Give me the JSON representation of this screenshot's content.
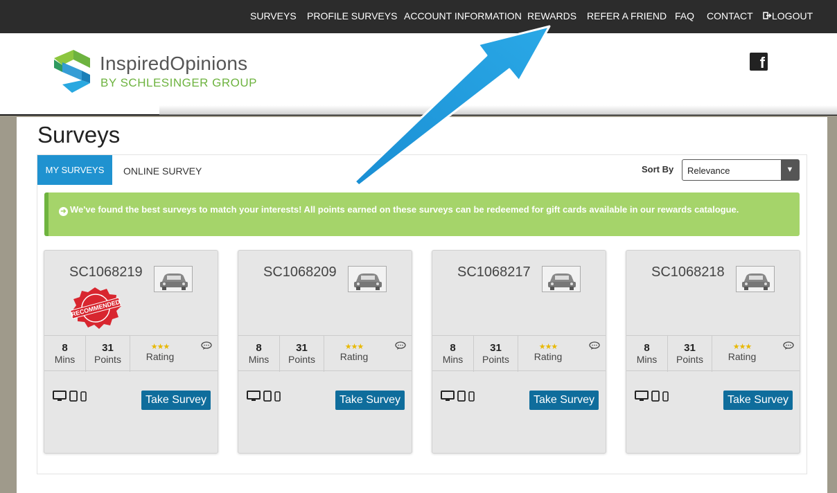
{
  "nav": {
    "items": [
      {
        "label": "SURVEYS",
        "name": "nav-surveys",
        "left": 0
      },
      {
        "label": "PROFILE SURVEYS"
      },
      {
        "label": "ACCOUNT INFORMATION"
      },
      {
        "label": "REWARDS"
      },
      {
        "label": "REFER A FRIEND"
      },
      {
        "label": "FAQ"
      },
      {
        "label": "CONTACT"
      },
      {
        "label": "LOGOUT",
        "icon": "logout-icon"
      }
    ]
  },
  "brand": {
    "name": "InspiredOpinions",
    "sub": "BY SCHLESINGER GROUP",
    "colors": {
      "green": "#6db33f",
      "blue": "#1f92d0",
      "gray": "#555555"
    }
  },
  "social": {
    "icon": "facebook-icon"
  },
  "page": {
    "title": "Surveys"
  },
  "tabs": [
    {
      "label": "MY SURVEYS",
      "active": true
    },
    {
      "label": "ONLINE SURVEY",
      "active": false
    }
  ],
  "sort": {
    "label": "Sort By",
    "value": "Relevance"
  },
  "alert": {
    "text": "We've found the best surveys to match your interests! All points earned on these surveys can be redeemed for gift cards available in our rewards catalogue.",
    "icon": "arrow-circle-right-icon"
  },
  "cards": [
    {
      "code": "SC1068219",
      "recommended": true,
      "badge_text": "RECOMMENDED",
      "mins": "8",
      "mins_label": "Mins",
      "points": "31",
      "points_label": "Points",
      "rating_stars": "★★★",
      "rating_label": "Rating",
      "button": "Take Survey"
    },
    {
      "code": "SC1068209",
      "recommended": false,
      "mins": "8",
      "mins_label": "Mins",
      "points": "31",
      "points_label": "Points",
      "rating_stars": "★★★",
      "rating_label": "Rating",
      "button": "Take Survey"
    },
    {
      "code": "SC1068217",
      "recommended": false,
      "mins": "8",
      "mins_label": "Mins",
      "points": "31",
      "points_label": "Points",
      "rating_stars": "★★★",
      "rating_label": "Rating",
      "button": "Take Survey"
    },
    {
      "code": "SC1068218",
      "recommended": false,
      "mins": "8",
      "mins_label": "Mins",
      "points": "31",
      "points_label": "Points",
      "rating_stars": "★★★",
      "rating_label": "Rating",
      "button": "Take Survey"
    }
  ],
  "colors": {
    "accent": "#1f92d0",
    "button": "#0f6d9c",
    "alert": "#a5d46a",
    "star": "#e8b800"
  }
}
